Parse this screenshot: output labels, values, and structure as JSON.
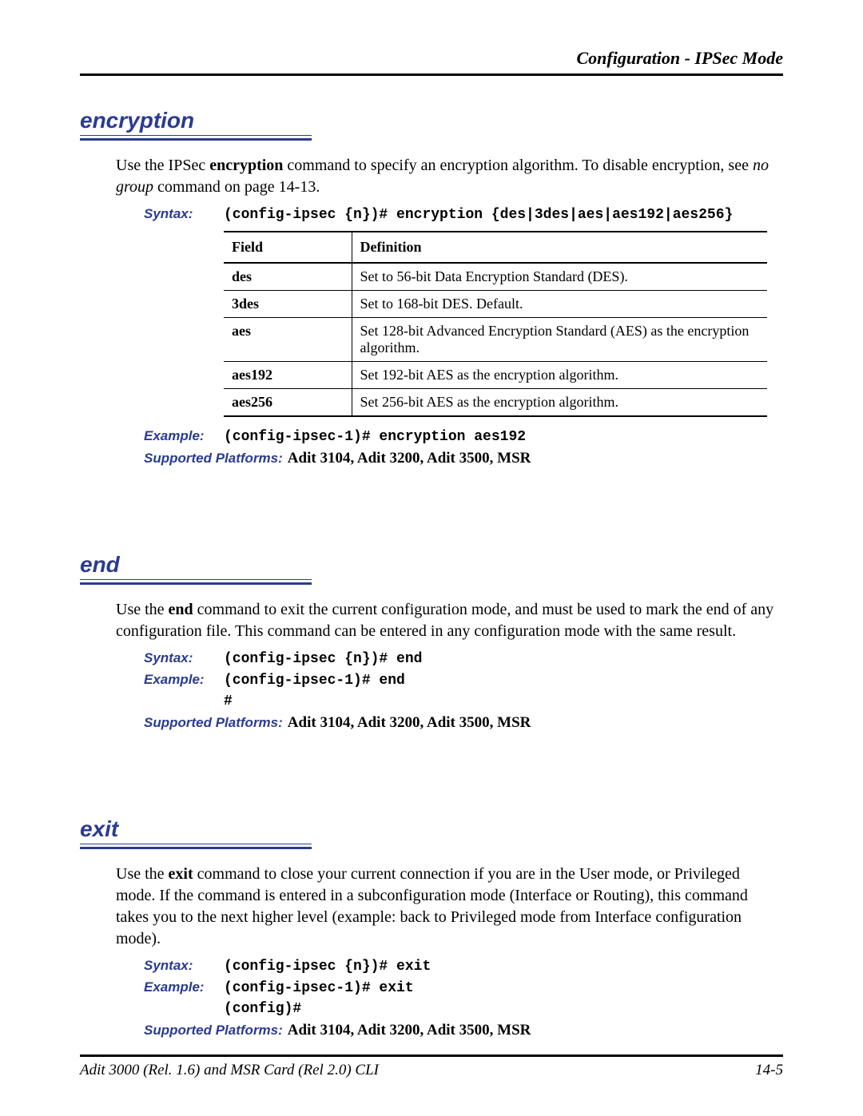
{
  "header": {
    "running": "Configuration - IPSec Mode"
  },
  "sections": {
    "encryption": {
      "title": "encryption",
      "intro_pre": "Use the IPSec ",
      "intro_cmd": "encryption",
      "intro_mid": " command to specify an encryption algorithm. To disable encryption, see ",
      "intro_link": "no group",
      "intro_post": " command on page 14-13.",
      "syntax_label": "Syntax:",
      "syntax_value": "(config-ipsec {n})# encryption {des|3des|aes|aes192|aes256}",
      "table": {
        "head_field": "Field",
        "head_def": "Definition",
        "rows": [
          {
            "field": "des",
            "def": "Set to 56-bit Data Encryption Standard (DES)."
          },
          {
            "field": "3des",
            "def": "Set to 168-bit DES. Default."
          },
          {
            "field": "aes",
            "def": "Set 128-bit Advanced Encryption Standard (AES) as the encryption algorithm."
          },
          {
            "field": "aes192",
            "def": "Set 192-bit AES as the encryption algorithm."
          },
          {
            "field": "aes256",
            "def": "Set 256-bit AES as the encryption algorithm."
          }
        ]
      },
      "example_label": "Example:",
      "example_value": "(config-ipsec-1)# encryption aes192",
      "platforms_label": "Supported Platforms:",
      "platforms_value": "Adit 3104, Adit 3200, Adit 3500, MSR"
    },
    "end": {
      "title": "end",
      "intro_pre": "Use the ",
      "intro_cmd": "end",
      "intro_post": " command to exit the current configuration mode, and must be used to mark the end of any configuration file.  This command can be entered in any configuration mode with the same result.",
      "syntax_label": "Syntax:",
      "syntax_value": "(config-ipsec {n})# end",
      "example_label": "Example:",
      "example_value_1": "(config-ipsec-1)# end",
      "example_value_2": "#",
      "platforms_label": "Supported Platforms:",
      "platforms_value": "Adit 3104, Adit 3200, Adit 3500, MSR"
    },
    "exit": {
      "title": "exit",
      "intro_pre": "Use the ",
      "intro_cmd": "exit",
      "intro_post": " command to close your current connection if you are in the User mode, or Privileged mode. If the command is entered in a subconfiguration mode (Interface or Routing), this command takes you to the next higher level (example: back to Privileged mode from Interface configuration mode).",
      "syntax_label": "Syntax:",
      "syntax_value": "(config-ipsec {n})# exit",
      "example_label": "Example:",
      "example_value_1": "(config-ipsec-1)# exit",
      "example_value_2": "(config)#",
      "platforms_label": "Supported Platforms:",
      "platforms_value": "Adit 3104, Adit 3200, Adit 3500, MSR"
    }
  },
  "footer": {
    "left": "Adit 3000 (Rel. 1.6) and MSR Card (Rel 2.0) CLI",
    "right": "14-5"
  }
}
